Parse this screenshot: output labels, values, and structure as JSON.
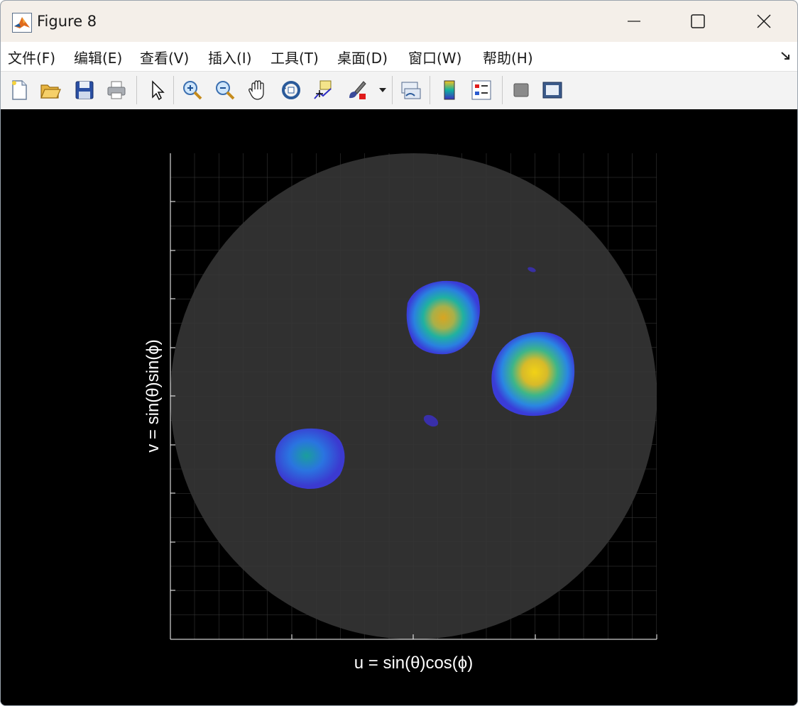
{
  "window": {
    "title": "Figure 8",
    "icon": "matlab-icon",
    "controls": [
      "minimize-icon",
      "maximize-icon",
      "close-icon"
    ]
  },
  "menu": {
    "items": [
      {
        "label": "文件(F)"
      },
      {
        "label": "编辑(E)"
      },
      {
        "label": "查看(V)"
      },
      {
        "label": "插入(I)"
      },
      {
        "label": "工具(T)"
      },
      {
        "label": "桌面(D)"
      },
      {
        "label": "窗口(W)"
      },
      {
        "label": "帮助(H)"
      }
    ]
  },
  "toolbar": {
    "buttons": [
      "new-figure-icon",
      "open-file-icon",
      "save-icon",
      "print-icon",
      "select-pointer-icon",
      "zoom-in-icon",
      "zoom-out-icon",
      "pan-hand-icon",
      "rotate-3d-icon",
      "data-cursor-icon",
      "brush-icon",
      "brush-dropdown-icon",
      "link-plot-icon",
      "colorbar-icon",
      "legend-icon",
      "hide-plot-tools-icon",
      "show-plot-tools-icon"
    ]
  },
  "plot": {
    "xlabel": "u = sin(θ)cos(ϕ)",
    "ylabel": "v = sin(θ)sin(ϕ)",
    "background": "#000000",
    "disk_color": "#303030",
    "grid": true,
    "colors": {
      "low": "#3b2fc0",
      "mid": "#10b0a0",
      "high": "#f7c21e"
    }
  }
}
